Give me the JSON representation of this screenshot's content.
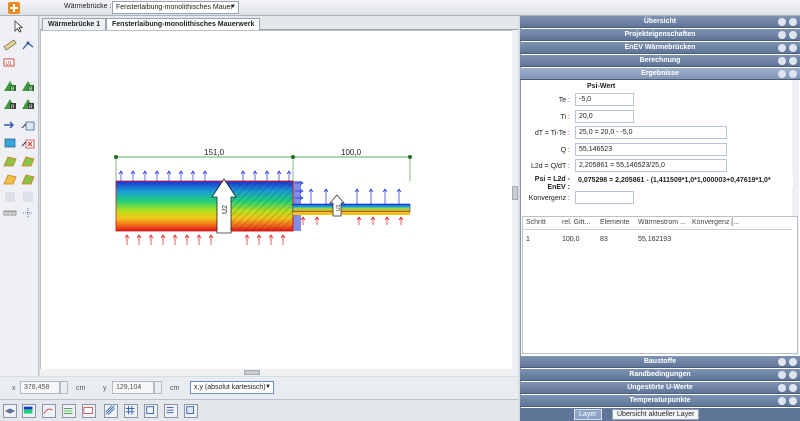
{
  "topbar": {
    "warmebrucke_label": "Wärmebrücke :",
    "warmebrucke_value": "Fensterlaibung-monolithisches Mauer"
  },
  "tabs": [
    {
      "label": "Wärmebrücke 1"
    },
    {
      "label": "Fensterlaibung-monolithisches Mauerwerk"
    }
  ],
  "drawing": {
    "dim_left": "151,0",
    "dim_right": "100,0",
    "label_u2": "U2",
    "label_u1": "U1"
  },
  "coords": {
    "x_label": "x",
    "x_value": "378,458",
    "x_unit": "cm",
    "y_label": "y",
    "y_value": "129,104",
    "y_unit": "cm",
    "system_value": "x,y (absolut kartesisch)"
  },
  "panel": {
    "sections_top": [
      {
        "label": "Übersicht"
      },
      {
        "label": "Projekteigenschaften"
      },
      {
        "label": "EnEV Wärmebrücken"
      },
      {
        "label": "Berechnung"
      },
      {
        "label": "Ergebnisse"
      }
    ],
    "sections_bottom": [
      {
        "label": "Baustoffe"
      },
      {
        "label": "Randbedingungen"
      },
      {
        "label": "Ungestörte U-Werte"
      },
      {
        "label": "Temperaturpunkte"
      }
    ],
    "psi_title": "Psi-Wert",
    "rows": {
      "te_label": "Te :",
      "te_value": "-5,0",
      "ti_label": "Ti :",
      "ti_value": "20,0",
      "dt_label": "dT = Ti-Te :",
      "dt_value": "25,0 = 20,0 - -5,0",
      "q_label": "Q :",
      "q_value": "55,146523",
      "l2d_label": "L2d = Q/dT :",
      "l2d_value": "2,205861 = 55,146523/25,0",
      "psi_label": "Psi = L2d -",
      "psi_label2": "EnEV :",
      "psi_value": "0,075298 = 2,205861 - (1,411509*1,0*1,000003+0,47619*1,0*",
      "konvergenz_label": "Konvergenz :",
      "konvergenz_value": ""
    },
    "table": {
      "headers": [
        "Schritt",
        "rel. Gitt...",
        "Elemente",
        "Wärmestrom ...",
        "Konvergenz [..."
      ],
      "rows": [
        [
          "1",
          "100,0",
          "83",
          "55,162193",
          ""
        ]
      ]
    },
    "layer_tabs": [
      {
        "label": "Layer"
      },
      {
        "label": "Übersicht aktueller Layer"
      }
    ]
  }
}
